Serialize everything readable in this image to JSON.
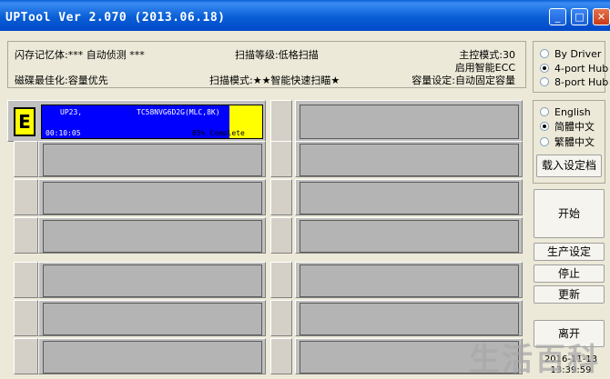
{
  "window": {
    "title": "UPTool Ver 2.070 (2013.06.18)",
    "minimize_glyph": "_",
    "maximize_glyph": "□",
    "close_glyph": "✕"
  },
  "info": {
    "flash_memory": "闪存记忆体:*** 自动侦测 ***",
    "scan_level": "扫描等级:低格扫描",
    "main_mode": "主控模式:30",
    "smart_ecc": "启用智能ECC",
    "disk_optimize": "磁碟最佳化:容量优先",
    "scan_mode": "扫描模式:★★智能快速扫瞄★",
    "capacity_setting": "容量设定:自动固定容量"
  },
  "active_port": {
    "letter": "E",
    "port": "UP23,",
    "chip": "TC58NVG6D2G(MLC,8K)",
    "time": "00:10:05",
    "status": "85% Complete",
    "progress_percent": 85
  },
  "hub_options": [
    {
      "label": "By Driver",
      "checked": false
    },
    {
      "label": "4-port Hub",
      "checked": true
    },
    {
      "label": "8-port Hub",
      "checked": false
    }
  ],
  "language_options": [
    {
      "label": "English",
      "checked": false
    },
    {
      "label": "简體中文",
      "checked": true
    },
    {
      "label": "繁體中文",
      "checked": false
    }
  ],
  "buttons": {
    "load_settings": "载入设定档",
    "start": "开始",
    "production_settings": "生产设定",
    "stop": "停止",
    "update": "更新",
    "exit": "离开"
  },
  "datetime": {
    "date": "2016-11-13",
    "time": "13:39:59"
  },
  "watermark": "生活百科"
}
